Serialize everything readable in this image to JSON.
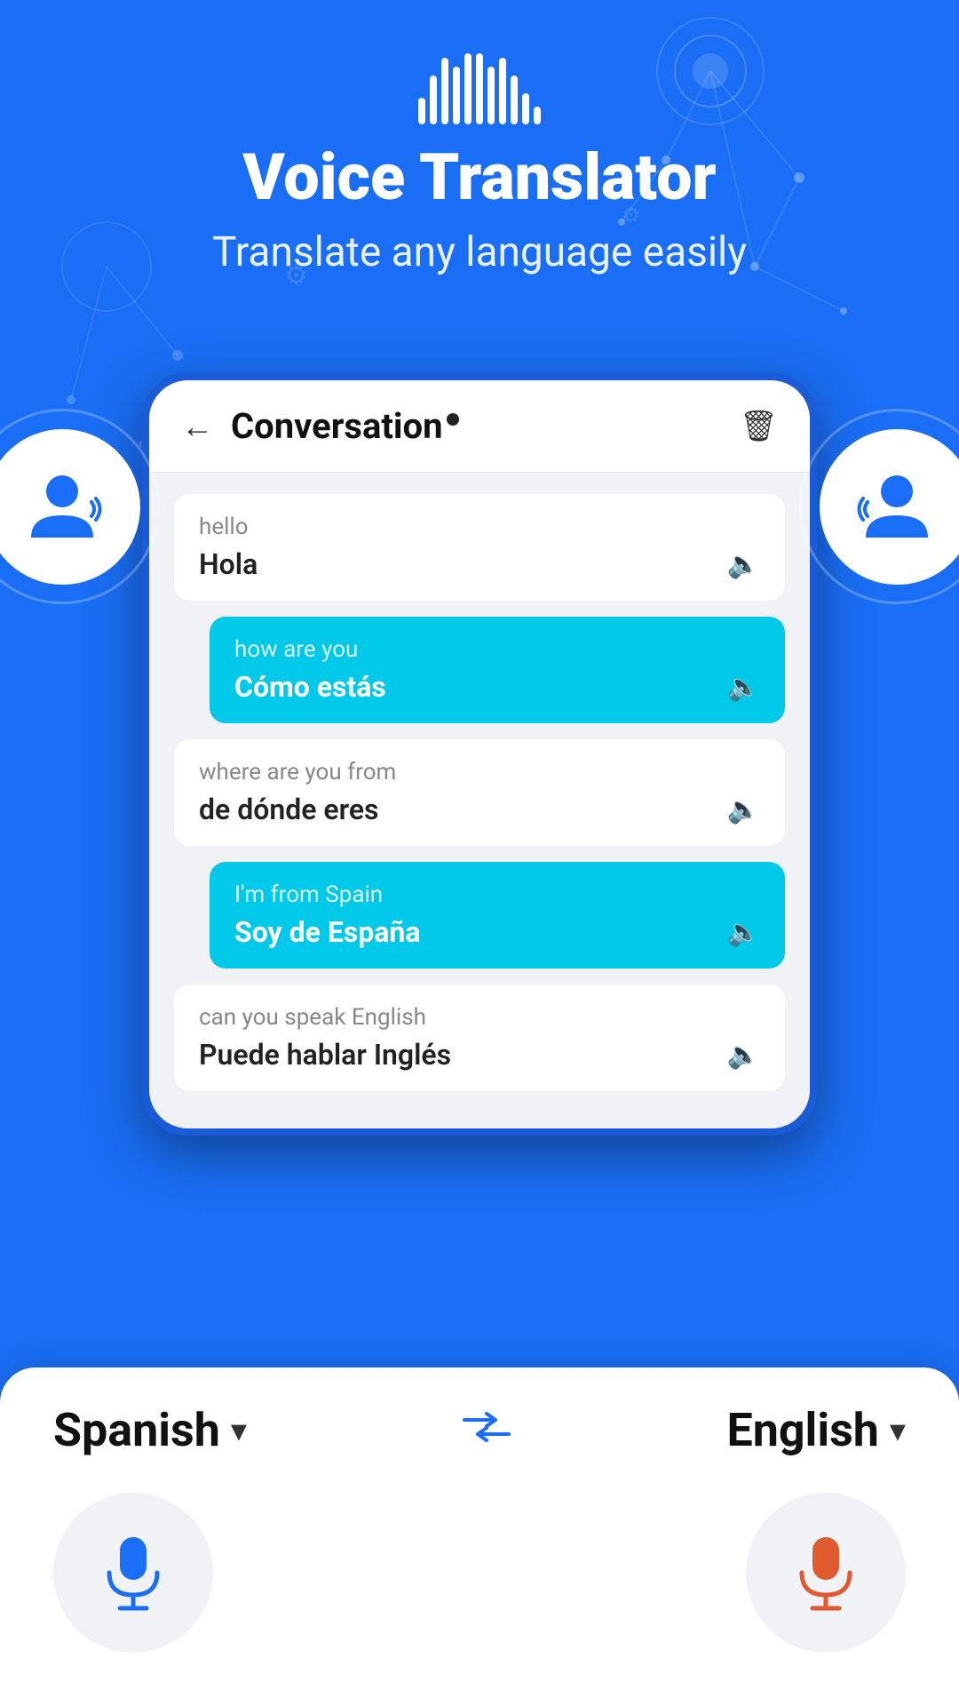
{
  "app": {
    "title": "Voice Translator",
    "subtitle": "Translate any language easily"
  },
  "appbar": {
    "title": "Conversation",
    "back_label": "←",
    "trash_label": "🗑"
  },
  "messages": [
    {
      "side": "left",
      "original": "hello",
      "translated": "Hola"
    },
    {
      "side": "right",
      "original": "how are you",
      "translated": "Cómo estás"
    },
    {
      "side": "left",
      "original": "where are you from",
      "translated": "de dónde eres"
    },
    {
      "side": "right",
      "original": "I'm from Spain",
      "translated": "Soy de España"
    },
    {
      "side": "left",
      "original": "can you speak English",
      "translated": "Puede hablar Inglés"
    }
  ],
  "bottom": {
    "lang_left": "Spanish",
    "lang_right": "English",
    "swap_icon": "⇄"
  },
  "waveform": {
    "bars": [
      20,
      35,
      55,
      70,
      80,
      65,
      75,
      60,
      45,
      30,
      20
    ]
  }
}
